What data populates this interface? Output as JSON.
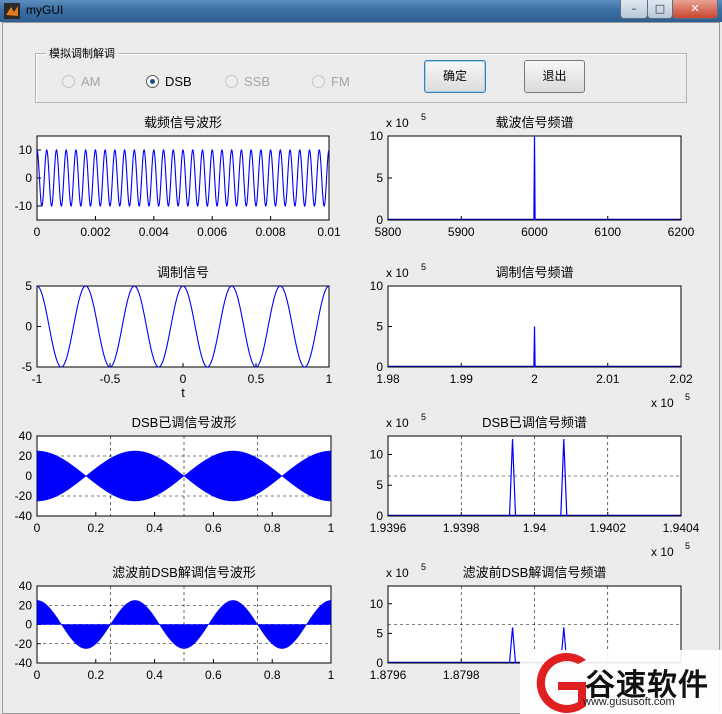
{
  "window": {
    "title": "myGUI",
    "minimize": "–",
    "maximize": "□",
    "close": "✕"
  },
  "group": {
    "label": "模拟调制解调"
  },
  "radios": [
    {
      "label": "AM",
      "selected": false,
      "enabled": false
    },
    {
      "label": "DSB",
      "selected": true,
      "enabled": true
    },
    {
      "label": "SSB",
      "selected": false,
      "enabled": false
    },
    {
      "label": "FM",
      "selected": false,
      "enabled": false
    }
  ],
  "buttons": {
    "ok": "确定",
    "exit": "退出"
  },
  "colors": {
    "trace": "#0000ff",
    "dark_trace": "#000080"
  },
  "watermark": {
    "text": "谷速软件",
    "url": "www.gususoft.com"
  },
  "chart_data": [
    {
      "id": "carrier-wave",
      "type": "line",
      "title": "载频信号波形",
      "xlim": [
        0,
        0.01
      ],
      "ylim": [
        -15,
        15
      ],
      "xticks": [
        "0",
        "0.002",
        "0.004",
        "0.006",
        "0.008",
        "0.01"
      ],
      "yticks": [
        "10",
        "0",
        "-10"
      ],
      "signal": {
        "kind": "sine",
        "amplitude": 10,
        "cycles": 30
      },
      "xlabel": "",
      "ylabel": ""
    },
    {
      "id": "carrier-spectrum",
      "type": "line",
      "title": "载波信号频谱",
      "xlim": [
        5800,
        6200
      ],
      "ylim": [
        0,
        1000000
      ],
      "xticks": [
        "5800",
        "5900",
        "6000",
        "6100",
        "6200"
      ],
      "yticks": [
        "10",
        "5",
        "0"
      ],
      "yexp": "x 10",
      "yexp_power": "5",
      "peaks": [
        {
          "x": 6000,
          "y": 1000000
        }
      ],
      "xlabel": "",
      "ylabel": ""
    },
    {
      "id": "modulating-signal",
      "type": "line",
      "title": "调制信号",
      "xlim": [
        -1,
        1
      ],
      "ylim": [
        -5,
        5
      ],
      "xticks": [
        "-1",
        "-0.5",
        "0",
        "0.5",
        "1"
      ],
      "yticks": [
        "5",
        "0",
        "-5"
      ],
      "signal": {
        "kind": "cosine",
        "amplitude": 5,
        "cycles": 6
      },
      "xlabel": "t",
      "ylabel": ""
    },
    {
      "id": "modulating-spectrum",
      "type": "line",
      "title": "调制信号频谱",
      "xlim": [
        198000,
        202000
      ],
      "ylim": [
        0,
        1000000
      ],
      "xticks": [
        "1.98",
        "1.99",
        "2",
        "2.01",
        "2.02"
      ],
      "xexp": "x 10",
      "xexp_power": "5",
      "yticks": [
        "10",
        "5",
        "0"
      ],
      "yexp": "x 10",
      "yexp_power": "5",
      "peaks": [
        {
          "x": 200000,
          "y": 500000
        }
      ],
      "xlabel": "",
      "ylabel": ""
    },
    {
      "id": "dsb-wave",
      "type": "area",
      "title": "DSB已调信号波形",
      "xlim": [
        0,
        1
      ],
      "ylim": [
        -40,
        40
      ],
      "xticks": [
        "0",
        "0.2",
        "0.4",
        "0.6",
        "0.8",
        "1"
      ],
      "yticks": [
        "40",
        "20",
        "0",
        "-20",
        "-40"
      ],
      "envelope": {
        "amplitude": 25,
        "cycles": 3
      },
      "grid": true,
      "xlabel": "",
      "ylabel": ""
    },
    {
      "id": "dsb-spectrum",
      "type": "line",
      "title": "DSB已调信号频谱",
      "xlim": [
        193960,
        194040
      ],
      "ylim": [
        0,
        1300000
      ],
      "xticks": [
        "1.9396",
        "1.9398",
        "1.94",
        "1.9402",
        "1.9404"
      ],
      "xexp": "x 10",
      "xexp_power": "5",
      "yticks": [
        "10",
        "5",
        "0"
      ],
      "yexp": "x 10",
      "yexp_power": "5",
      "peaks": [
        {
          "x": 193994,
          "y": 1250000
        },
        {
          "x": 194008,
          "y": 1250000
        }
      ],
      "grid": true,
      "xlabel": "",
      "ylabel": ""
    },
    {
      "id": "demod-wave",
      "type": "area",
      "title": "滤波前DSB解调信号波形",
      "xlim": [
        0,
        1
      ],
      "ylim": [
        -40,
        40
      ],
      "xticks": [
        "0",
        "0.2",
        "0.4",
        "0.6",
        "0.8",
        "1"
      ],
      "yticks": [
        "40",
        "20",
        "0",
        "-20",
        "-40"
      ],
      "envelope": {
        "amplitude": 25,
        "cycles": 3
      },
      "grid": true,
      "xlabel": "",
      "ylabel": ""
    },
    {
      "id": "demod-spectrum",
      "type": "line",
      "title": "滤波前DSB解调信号频谱",
      "xlim": [
        187960,
        188040
      ],
      "ylim": [
        0,
        1300000
      ],
      "xticks": [
        "1.8796",
        "1.8798"
      ],
      "yticks": [
        "10",
        "5",
        "0"
      ],
      "yexp": "x 10",
      "yexp_power": "5",
      "peaks": [
        {
          "x": 187994,
          "y": 600000
        },
        {
          "x": 188008,
          "y": 600000
        }
      ],
      "grid": true,
      "xlabel": "",
      "ylabel": ""
    }
  ]
}
